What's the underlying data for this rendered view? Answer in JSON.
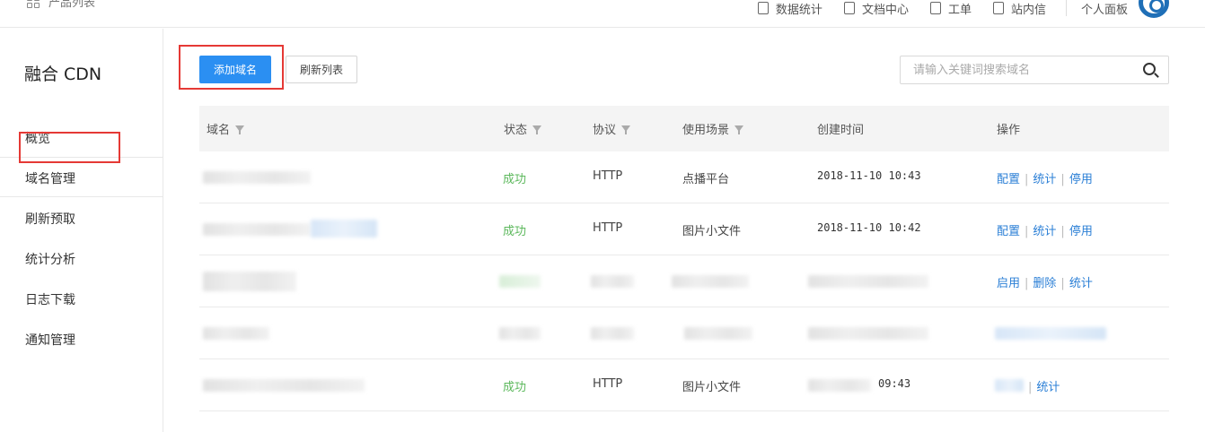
{
  "topbar": {
    "product_list": "产品列表",
    "nav": [
      "数据统计",
      "文档中心",
      "工单",
      "站内信"
    ],
    "personal_panel": "个人面板"
  },
  "sidebar": {
    "title": "融合 CDN",
    "items": [
      "概览",
      "域名管理",
      "刷新预取",
      "统计分析",
      "日志下载",
      "通知管理"
    ]
  },
  "toolbar": {
    "add_domain": "添加域名",
    "refresh_list": "刷新列表",
    "search_placeholder": "请输入关键词搜索域名"
  },
  "table": {
    "columns": [
      "域名",
      "状态",
      "协议",
      "使用场景",
      "创建时间",
      "操作"
    ],
    "rows": [
      {
        "status": "成功",
        "protocol": "HTTP",
        "scene": "点播平台",
        "created": "2018-11-10 10:43",
        "actions": [
          "配置",
          "统计",
          "停用"
        ]
      },
      {
        "status": "成功",
        "protocol": "HTTP",
        "scene": "图片小文件",
        "created": "2018-11-10 10:42",
        "actions": [
          "配置",
          "统计",
          "停用"
        ]
      },
      {
        "status": "",
        "protocol": "",
        "scene": "",
        "created": "",
        "actions": [
          "启用",
          "删除",
          "统计"
        ]
      },
      {
        "status": "",
        "protocol": "",
        "scene": "",
        "created": "",
        "actions": []
      },
      {
        "status": "成功",
        "protocol": "HTTP",
        "scene": "图片小文件",
        "created": "09:43",
        "actions": [
          "统计"
        ]
      }
    ]
  },
  "colors": {
    "primary": "#2b8ff2",
    "link": "#2b7fd6",
    "success": "#5cb85c",
    "highlight": "#e53935"
  }
}
